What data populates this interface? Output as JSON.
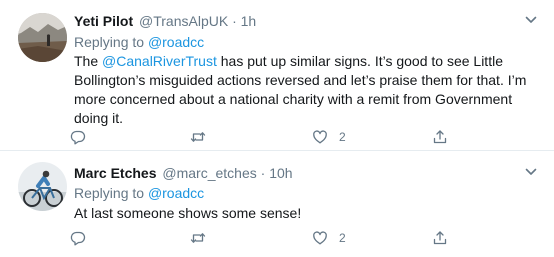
{
  "tweets": [
    {
      "display_name": "Yeti Pilot",
      "handle": "@TransAlpUK",
      "separator": "·",
      "time": "1h",
      "replying_prefix": "Replying to",
      "replying_to": "@roadcc",
      "text_before": "The ",
      "text_mention": "@CanalRiverTrust",
      "text_after": " has put up similar signs. It’s good to see Little Bollington’s misguided actions reversed and let’s praise them for that. I’m more concerned about a national charity with a remit from Government doing it.",
      "like_count": "2"
    },
    {
      "display_name": "Marc Etches",
      "handle": "@marc_etches",
      "separator": "·",
      "time": "10h",
      "replying_prefix": "Replying to",
      "replying_to": "@roadcc",
      "text": "At last someone shows some sense!",
      "like_count": "2"
    }
  ],
  "icons": {
    "reply": "reply-icon",
    "retweet": "retweet-icon",
    "like": "heart-icon",
    "share": "share-icon",
    "caret": "chevron-down-icon"
  },
  "colors": {
    "link": "#1b95e0",
    "secondary_text": "#657786",
    "divider": "#e6ecf0"
  }
}
